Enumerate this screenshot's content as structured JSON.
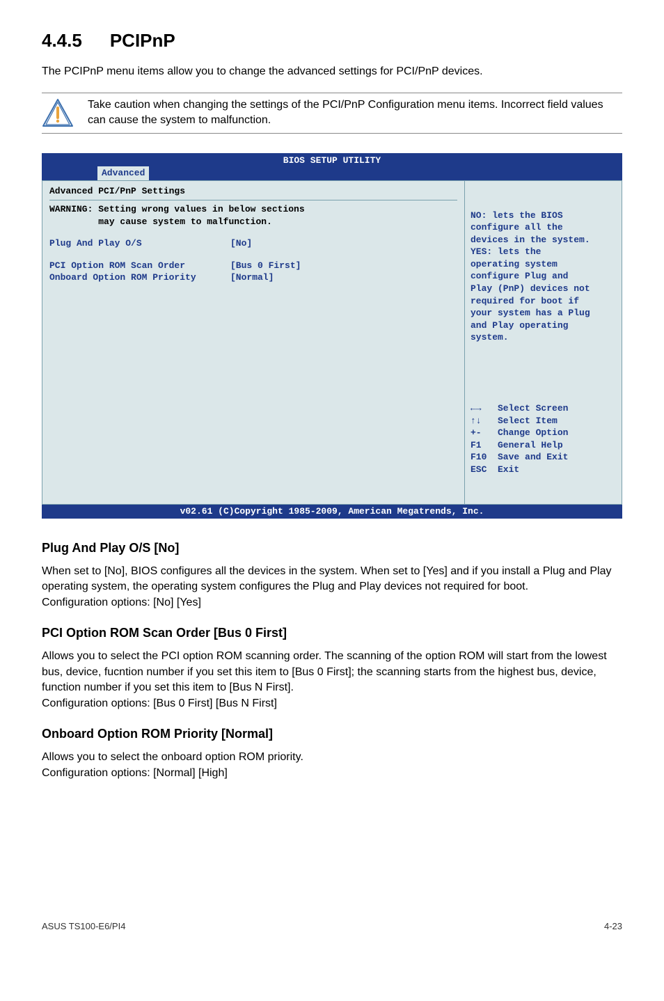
{
  "section": {
    "number": "4.4.5",
    "title": "PCIPnP"
  },
  "intro": "The PCIPnP menu items allow you to change the advanced settings for PCI/PnP devices.",
  "caution": "Take caution when changing the settings of the PCI/PnP Configuration menu items. Incorrect field values can cause the system to malfunction.",
  "bios": {
    "title": "BIOS SETUP UTILITY",
    "tab": "Advanced",
    "left": {
      "heading": "Advanced PCI/PnP Settings",
      "warn1": "WARNING: Setting wrong values in below sections",
      "warn2": "         may cause system to malfunction.",
      "row1": {
        "label": "Plug And Play O/S",
        "value": "[No]"
      },
      "row2": {
        "label": "PCI Option ROM Scan Order",
        "value": "[Bus 0 First]"
      },
      "row3": {
        "label": "Onboard Option ROM Priority",
        "value": "[Normal]"
      }
    },
    "help": "NO: lets the BIOS\nconfigure all the\ndevices in the system.\nYES: lets the\noperating system\nconfigure Plug and\nPlay (PnP) devices not\nrequired for boot if\nyour system has a Plug\nand Play operating\nsystem.",
    "keys": "←→   Select Screen\n↑↓   Select Item\n+-   Change Option\nF1   General Help\nF10  Save and Exit\nESC  Exit",
    "footer": "v02.61 (C)Copyright 1985-2009, American Megatrends, Inc."
  },
  "sub1": {
    "title": "Plug And Play O/S [No]",
    "body": "When set to [No], BIOS configures all the devices in the system. When set to [Yes] and if you install a Plug and Play operating system, the operating system configures the Plug and Play devices not required for boot.\nConfiguration options: [No] [Yes]"
  },
  "sub2": {
    "title": "PCI Option ROM Scan Order [Bus 0 First]",
    "body": "Allows you to select the PCI option ROM scanning order. The scanning of the option ROM will start from the lowest bus, device, fucntion number if you set this item to [Bus 0 First]; the scanning starts from the highest bus, device, function number if you set this item to [Bus N First].\nConfiguration options: [Bus 0 First] [Bus N First]"
  },
  "sub3": {
    "title": "Onboard Option ROM Priority [Normal]",
    "body": "Allows you to select the onboard option ROM priority.\nConfiguration options: [Normal] [High]"
  },
  "footer": {
    "left": "ASUS TS100-E6/PI4",
    "right": "4-23"
  }
}
